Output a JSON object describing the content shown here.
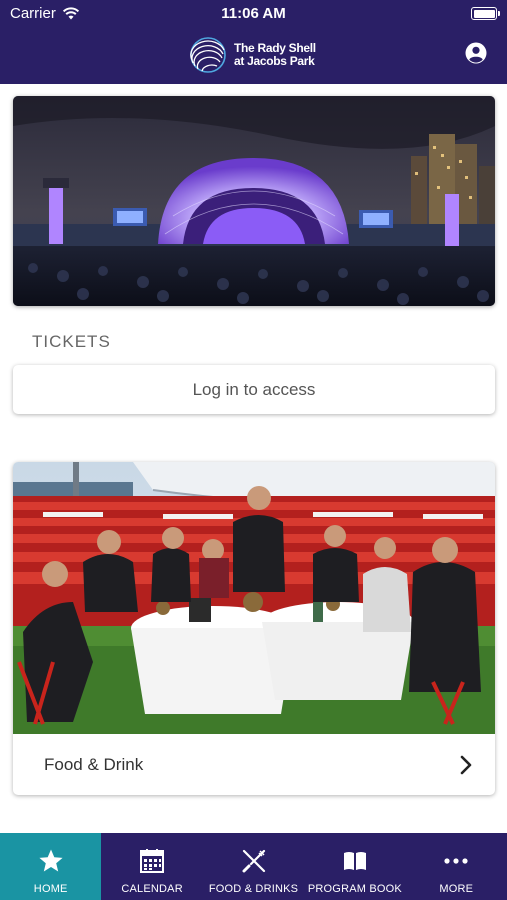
{
  "status_bar": {
    "carrier": "Carrier",
    "time": "11:06 AM"
  },
  "header": {
    "logo_line1": "The Rady Shell",
    "logo_line2": "at Jacobs Park",
    "profile_icon": "profile-icon",
    "background_color": "#2a1f66"
  },
  "hero": {
    "image": "rady-shell-concert-at-night"
  },
  "tickets": {
    "section_title": "TICKETS",
    "login_label": "Log in to access"
  },
  "food_card": {
    "image": "chefs-at-dinner-tables",
    "label": "Food & Drink",
    "chevron_icon": "chevron-right-icon"
  },
  "tab_bar": {
    "active_color": "#1a94a3",
    "items": [
      {
        "label": "HOME",
        "icon": "star-icon",
        "active": true
      },
      {
        "label": "CALENDAR",
        "icon": "calendar-icon",
        "active": false
      },
      {
        "label": "FOOD & DRINKS",
        "icon": "utensils-icon",
        "active": false
      },
      {
        "label": "PROGRAM BOOK",
        "icon": "book-icon",
        "active": false
      },
      {
        "label": "MORE",
        "icon": "more-dots-icon",
        "active": false
      }
    ]
  }
}
